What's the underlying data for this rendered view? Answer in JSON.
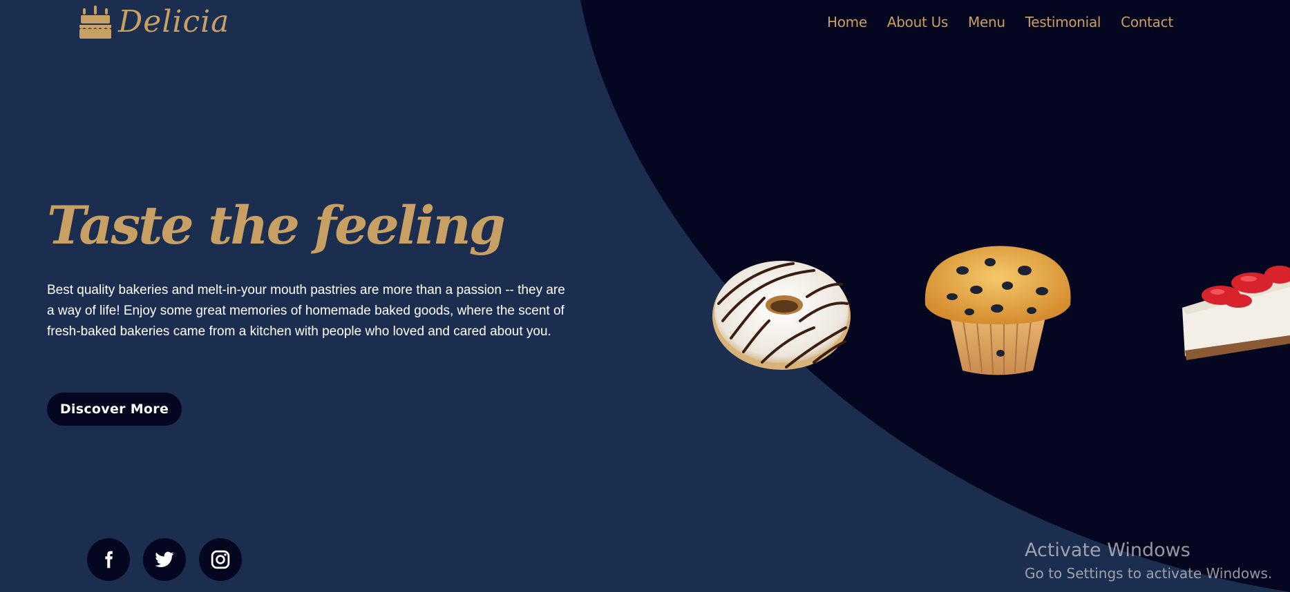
{
  "brand": {
    "name": "Delicia",
    "logo_icon": "cake-icon"
  },
  "nav": {
    "items": [
      "Home",
      "About Us",
      "Menu",
      "Testimonial",
      "Contact"
    ]
  },
  "hero": {
    "title": "Taste the feeling",
    "description": "Best quality bakeries and melt-in-your mouth pastries are more than a passion -- they are a way of life! Enjoy some great memories of homemade baked goods, where the scent of fresh-baked bakeries came from a kitchen with people who loved and cared about you.",
    "cta_label": "Discover More"
  },
  "products": [
    {
      "name": "donut",
      "icon": "donut-image"
    },
    {
      "name": "muffin",
      "icon": "muffin-image"
    },
    {
      "name": "cheesecake",
      "icon": "cheesecake-image"
    }
  ],
  "social": [
    {
      "name": "facebook",
      "icon": "facebook-icon"
    },
    {
      "name": "twitter",
      "icon": "twitter-icon"
    },
    {
      "name": "instagram",
      "icon": "instagram-icon"
    }
  ],
  "os_watermark": {
    "title": "Activate Windows",
    "subtitle": "Go to Settings to activate Windows."
  },
  "colors": {
    "background": "#1c2e4f",
    "dark_panel": "#05061f",
    "accent_gold": "#c9a063",
    "text": "#ffffff"
  }
}
